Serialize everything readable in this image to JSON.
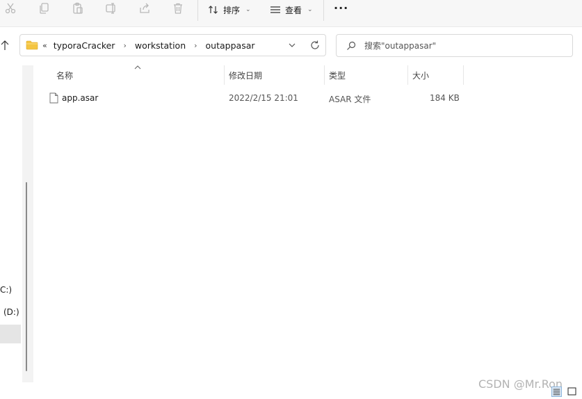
{
  "toolbar": {
    "sort_label": "排序",
    "view_label": "查看",
    "more_label": "···"
  },
  "address": {
    "prefix": "«",
    "crumbs": [
      "typoraCracker",
      "workstation",
      "outappasar"
    ]
  },
  "search": {
    "placeholder": "搜索\"outappasar\""
  },
  "nav": {
    "items": [
      "C:)",
      "(D:)"
    ]
  },
  "columns": {
    "name": "名称",
    "modified": "修改日期",
    "type": "类型",
    "size": "大小"
  },
  "files": [
    {
      "name": "app.asar",
      "modified": "2022/2/15 21:01",
      "type": "ASAR 文件",
      "size": "184 KB"
    }
  ],
  "watermark": "CSDN @Mr.Ron",
  "colors": {
    "folder": "#f4c542",
    "selection": "#e5e5e5",
    "toolbar_bg": "#f7f7f7"
  }
}
